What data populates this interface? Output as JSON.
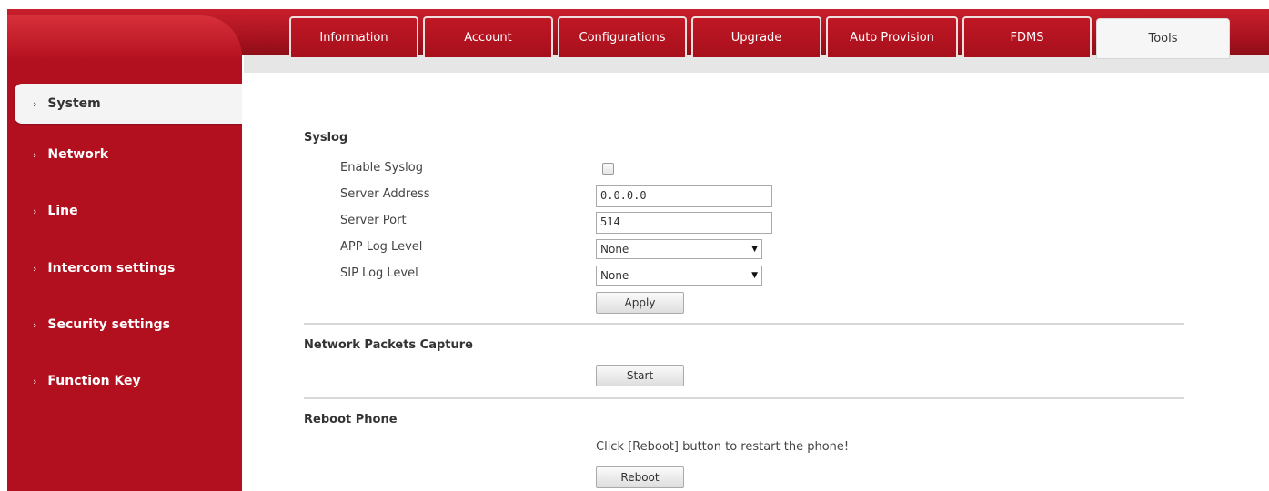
{
  "tabs": [
    {
      "label": "Information"
    },
    {
      "label": "Account"
    },
    {
      "label": "Configurations"
    },
    {
      "label": "Upgrade"
    },
    {
      "label": "Auto Provision"
    },
    {
      "label": "FDMS"
    },
    {
      "label": "Tools"
    }
  ],
  "sidebar": {
    "items": [
      {
        "label": "System"
      },
      {
        "label": "Network"
      },
      {
        "label": "Line"
      },
      {
        "label": "Intercom settings"
      },
      {
        "label": "Security settings"
      },
      {
        "label": "Function Key"
      }
    ],
    "chevron": "›"
  },
  "syslog": {
    "title": "Syslog",
    "enable_label": "Enable Syslog",
    "enable_checked": false,
    "server_address_label": "Server Address",
    "server_address_value": "0.0.0.0",
    "server_port_label": "Server Port",
    "server_port_value": "514",
    "app_log_level_label": "APP Log Level",
    "app_log_level_value": "None",
    "sip_log_level_label": "SIP Log Level",
    "sip_log_level_value": "None",
    "apply_label": "Apply"
  },
  "capture": {
    "title": "Network Packets Capture",
    "start_label": "Start"
  },
  "reboot": {
    "title": "Reboot Phone",
    "hint": "Click [Reboot] button to restart the phone!",
    "reboot_label": "Reboot"
  },
  "icons": {
    "dropdown": "▼"
  },
  "colors": {
    "brand_red": "#b3101f",
    "active_tab_bg": "#f6f6f6"
  }
}
